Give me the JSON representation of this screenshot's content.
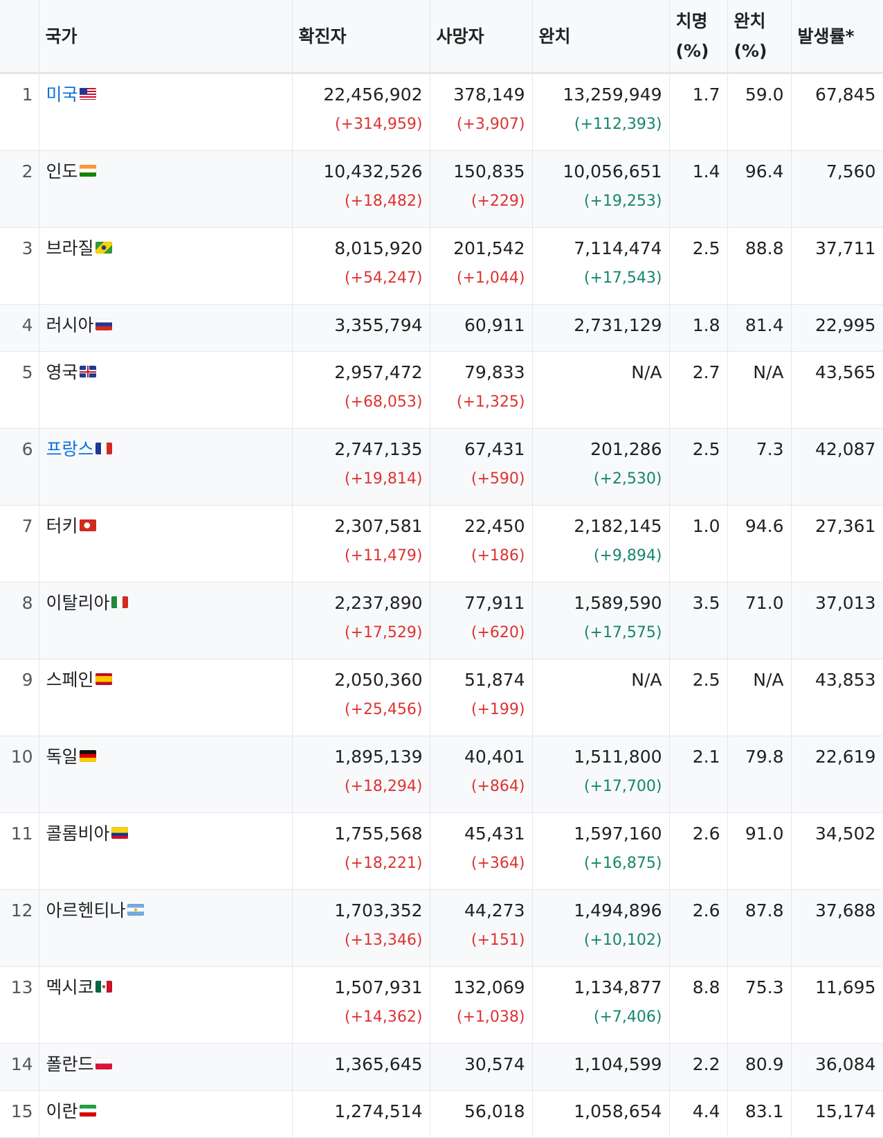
{
  "headers": {
    "country": "국가",
    "confirmed": "확진자",
    "deaths": "사망자",
    "recovered": "완치",
    "fatality_line1": "치명",
    "fatality_line2": "(%)",
    "recovery_line1": "완치",
    "recovery_line2": "(%)",
    "incidence": "발생률*"
  },
  "rows": [
    {
      "rank": "1",
      "country": "미국",
      "flag": "us-flag",
      "linked": true,
      "confirmed": "22,456,902",
      "confirmed_delta": "(+314,959)",
      "deaths": "378,149",
      "deaths_delta": "(+3,907)",
      "recovered": "13,259,949",
      "recovered_delta": "(+112,393)",
      "fatality": "1.7",
      "recovery": "59.0",
      "incidence": "67,845"
    },
    {
      "rank": "2",
      "country": "인도",
      "flag": "india-flag",
      "linked": false,
      "confirmed": "10,432,526",
      "confirmed_delta": "(+18,482)",
      "deaths": "150,835",
      "deaths_delta": "(+229)",
      "recovered": "10,056,651",
      "recovered_delta": "(+19,253)",
      "fatality": "1.4",
      "recovery": "96.4",
      "incidence": "7,560"
    },
    {
      "rank": "3",
      "country": "브라질",
      "flag": "brazil-flag",
      "linked": false,
      "confirmed": "8,015,920",
      "confirmed_delta": "(+54,247)",
      "deaths": "201,542",
      "deaths_delta": "(+1,044)",
      "recovered": "7,114,474",
      "recovered_delta": "(+17,543)",
      "fatality": "2.5",
      "recovery": "88.8",
      "incidence": "37,711"
    },
    {
      "rank": "4",
      "country": "러시아",
      "flag": "russia-flag",
      "linked": false,
      "confirmed": "3,355,794",
      "confirmed_delta": "",
      "deaths": "60,911",
      "deaths_delta": "",
      "recovered": "2,731,129",
      "recovered_delta": "",
      "fatality": "1.8",
      "recovery": "81.4",
      "incidence": "22,995"
    },
    {
      "rank": "5",
      "country": "영국",
      "flag": "uk-flag",
      "linked": false,
      "confirmed": "2,957,472",
      "confirmed_delta": "(+68,053)",
      "deaths": "79,833",
      "deaths_delta": "(+1,325)",
      "recovered": "N/A",
      "recovered_delta": "",
      "fatality": "2.7",
      "recovery": "N/A",
      "incidence": "43,565"
    },
    {
      "rank": "6",
      "country": "프랑스",
      "flag": "france-flag",
      "linked": true,
      "confirmed": "2,747,135",
      "confirmed_delta": "(+19,814)",
      "deaths": "67,431",
      "deaths_delta": "(+590)",
      "recovered": "201,286",
      "recovered_delta": "(+2,530)",
      "fatality": "2.5",
      "recovery": "7.3",
      "incidence": "42,087"
    },
    {
      "rank": "7",
      "country": "터키",
      "flag": "turkey-flag",
      "linked": false,
      "confirmed": "2,307,581",
      "confirmed_delta": "(+11,479)",
      "deaths": "22,450",
      "deaths_delta": "(+186)",
      "recovered": "2,182,145",
      "recovered_delta": "(+9,894)",
      "fatality": "1.0",
      "recovery": "94.6",
      "incidence": "27,361"
    },
    {
      "rank": "8",
      "country": "이탈리아",
      "flag": "italy-flag",
      "linked": false,
      "confirmed": "2,237,890",
      "confirmed_delta": "(+17,529)",
      "deaths": "77,911",
      "deaths_delta": "(+620)",
      "recovered": "1,589,590",
      "recovered_delta": "(+17,575)",
      "fatality": "3.5",
      "recovery": "71.0",
      "incidence": "37,013"
    },
    {
      "rank": "9",
      "country": "스페인",
      "flag": "spain-flag",
      "linked": false,
      "confirmed": "2,050,360",
      "confirmed_delta": "(+25,456)",
      "deaths": "51,874",
      "deaths_delta": "(+199)",
      "recovered": "N/A",
      "recovered_delta": "",
      "fatality": "2.5",
      "recovery": "N/A",
      "incidence": "43,853"
    },
    {
      "rank": "10",
      "country": "독일",
      "flag": "germany-flag",
      "linked": false,
      "confirmed": "1,895,139",
      "confirmed_delta": "(+18,294)",
      "deaths": "40,401",
      "deaths_delta": "(+864)",
      "recovered": "1,511,800",
      "recovered_delta": "(+17,700)",
      "fatality": "2.1",
      "recovery": "79.8",
      "incidence": "22,619"
    },
    {
      "rank": "11",
      "country": "콜롬비아",
      "flag": "colombia-flag",
      "linked": false,
      "confirmed": "1,755,568",
      "confirmed_delta": "(+18,221)",
      "deaths": "45,431",
      "deaths_delta": "(+364)",
      "recovered": "1,597,160",
      "recovered_delta": "(+16,875)",
      "fatality": "2.6",
      "recovery": "91.0",
      "incidence": "34,502"
    },
    {
      "rank": "12",
      "country": "아르헨티나",
      "flag": "argentina-flag",
      "linked": false,
      "confirmed": "1,703,352",
      "confirmed_delta": "(+13,346)",
      "deaths": "44,273",
      "deaths_delta": "(+151)",
      "recovered": "1,494,896",
      "recovered_delta": "(+10,102)",
      "fatality": "2.6",
      "recovery": "87.8",
      "incidence": "37,688"
    },
    {
      "rank": "13",
      "country": "멕시코",
      "flag": "mexico-flag",
      "linked": false,
      "confirmed": "1,507,931",
      "confirmed_delta": "(+14,362)",
      "deaths": "132,069",
      "deaths_delta": "(+1,038)",
      "recovered": "1,134,877",
      "recovered_delta": "(+7,406)",
      "fatality": "8.8",
      "recovery": "75.3",
      "incidence": "11,695"
    },
    {
      "rank": "14",
      "country": "폴란드",
      "flag": "poland-flag",
      "linked": false,
      "confirmed": "1,365,645",
      "confirmed_delta": "",
      "deaths": "30,574",
      "deaths_delta": "",
      "recovered": "1,104,599",
      "recovered_delta": "",
      "fatality": "2.2",
      "recovery": "80.9",
      "incidence": "36,084"
    },
    {
      "rank": "15",
      "country": "이란",
      "flag": "iran-flag",
      "linked": false,
      "confirmed": "1,274,514",
      "confirmed_delta": "",
      "deaths": "56,018",
      "deaths_delta": "",
      "recovered": "1,058,654",
      "recovered_delta": "",
      "fatality": "4.4",
      "recovery": "83.1",
      "incidence": "15,174"
    }
  ],
  "colors": {
    "link": "#0b6ee0",
    "increase_negative": "#d33333",
    "increase_positive": "#14866d",
    "header_bg": "#f8f9fa",
    "border": "#e4e6ea"
  }
}
